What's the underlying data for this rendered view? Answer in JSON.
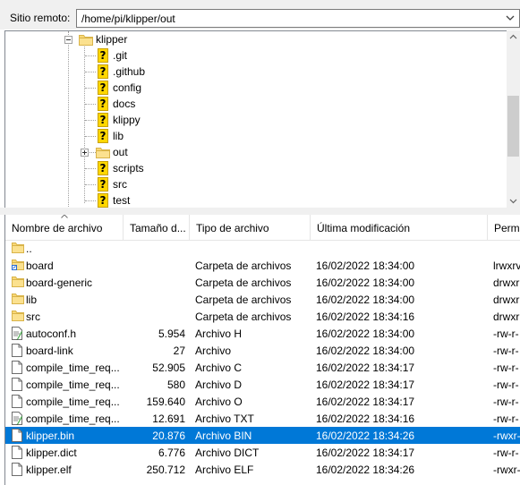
{
  "remote": {
    "label": "Sitio remoto:",
    "path": "/home/pi/klipper/out"
  },
  "tree": {
    "root": "klipper",
    "items": [
      {
        "name": ".git",
        "icon": "unknown-icon"
      },
      {
        "name": ".github",
        "icon": "unknown-icon"
      },
      {
        "name": "config",
        "icon": "unknown-icon"
      },
      {
        "name": "docs",
        "icon": "unknown-icon"
      },
      {
        "name": "klippy",
        "icon": "unknown-icon"
      },
      {
        "name": "lib",
        "icon": "unknown-icon"
      },
      {
        "name": "out",
        "icon": "folder-icon"
      },
      {
        "name": "scripts",
        "icon": "unknown-icon"
      },
      {
        "name": "src",
        "icon": "unknown-icon"
      },
      {
        "name": "test",
        "icon": "unknown-icon"
      }
    ]
  },
  "columns": {
    "name": "Nombre de archivo",
    "size": "Tamaño d...",
    "type": "Tipo de archivo",
    "modified": "Última modificación",
    "perms": "Permi"
  },
  "files": [
    {
      "name": "..",
      "size": "",
      "type": "",
      "modified": "",
      "perms": "",
      "icon": "folder-icon"
    },
    {
      "name": "board",
      "size": "",
      "type": "Carpeta de archivos",
      "modified": "16/02/2022 18:34:00",
      "perms": "lrwxrv",
      "icon": "folder-link-icon"
    },
    {
      "name": "board-generic",
      "size": "",
      "type": "Carpeta de archivos",
      "modified": "16/02/2022 18:34:00",
      "perms": "drwxr",
      "icon": "folder-icon"
    },
    {
      "name": "lib",
      "size": "",
      "type": "Carpeta de archivos",
      "modified": "16/02/2022 18:34:00",
      "perms": "drwxr",
      "icon": "folder-icon"
    },
    {
      "name": "src",
      "size": "",
      "type": "Carpeta de archivos",
      "modified": "16/02/2022 18:34:16",
      "perms": "drwxr",
      "icon": "folder-icon"
    },
    {
      "name": "autoconf.h",
      "size": "5.954",
      "type": "Archivo H",
      "modified": "16/02/2022 18:34:00",
      "perms": "-rw-r-",
      "icon": "text-file-icon"
    },
    {
      "name": "board-link",
      "size": "27",
      "type": "Archivo",
      "modified": "16/02/2022 18:34:00",
      "perms": "-rw-r-",
      "icon": "file-icon"
    },
    {
      "name": "compile_time_req...",
      "size": "52.905",
      "type": "Archivo C",
      "modified": "16/02/2022 18:34:17",
      "perms": "-rw-r-",
      "icon": "file-icon"
    },
    {
      "name": "compile_time_req...",
      "size": "580",
      "type": "Archivo D",
      "modified": "16/02/2022 18:34:17",
      "perms": "-rw-r-",
      "icon": "file-icon"
    },
    {
      "name": "compile_time_req...",
      "size": "159.640",
      "type": "Archivo O",
      "modified": "16/02/2022 18:34:17",
      "perms": "-rw-r-",
      "icon": "file-icon"
    },
    {
      "name": "compile_time_req...",
      "size": "12.691",
      "type": "Archivo TXT",
      "modified": "16/02/2022 18:34:16",
      "perms": "-rw-r-",
      "icon": "text-file-icon"
    },
    {
      "name": "klipper.bin",
      "size": "20.876",
      "type": "Archivo BIN",
      "modified": "16/02/2022 18:34:26",
      "perms": "-rwxr-",
      "icon": "file-icon",
      "selected": true
    },
    {
      "name": "klipper.dict",
      "size": "6.776",
      "type": "Archivo DICT",
      "modified": "16/02/2022 18:34:17",
      "perms": "-rw-r-",
      "icon": "file-icon"
    },
    {
      "name": "klipper.elf",
      "size": "250.712",
      "type": "Archivo ELF",
      "modified": "16/02/2022 18:34:26",
      "perms": "-rwxr-",
      "icon": "file-icon"
    }
  ]
}
